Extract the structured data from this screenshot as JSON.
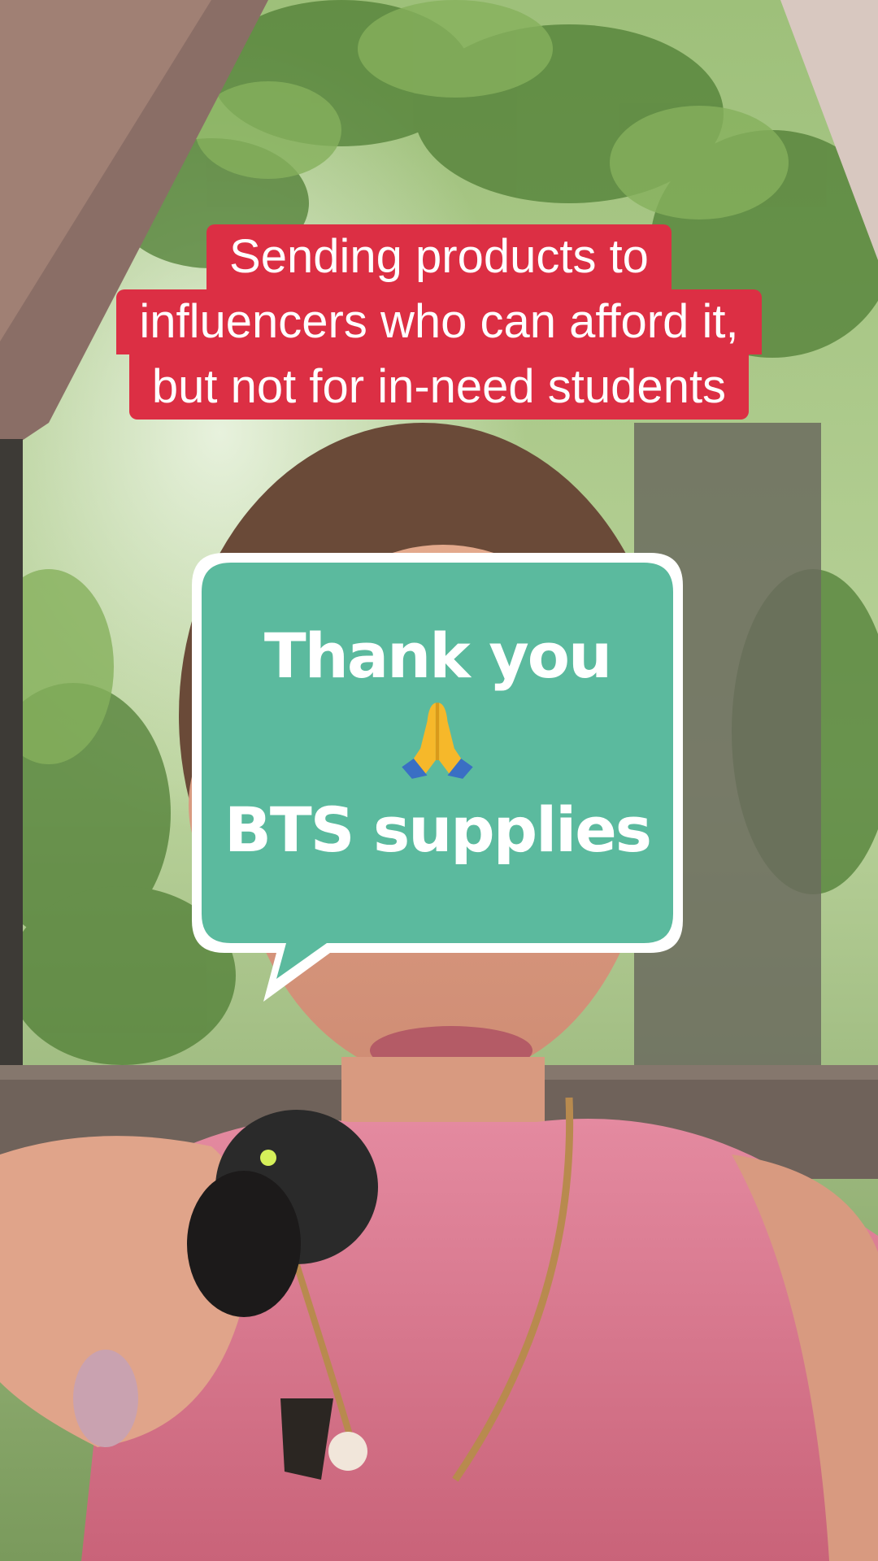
{
  "caption": {
    "line1": "Sending products to",
    "line2": "influencers who can afford it,",
    "line3": "but not for in-need students"
  },
  "sticker": {
    "line1": "Thank you",
    "emoji": "folded-hands-emoji",
    "line2": "BTS supplies"
  },
  "colors": {
    "caption_bg": "#dc2f44",
    "sticker_bg": "#5bba9e",
    "sticker_border": "#ffffff",
    "text": "#ffffff"
  }
}
